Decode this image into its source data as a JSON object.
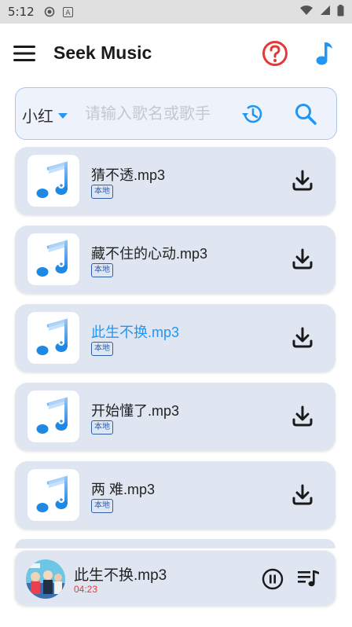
{
  "status_bar": {
    "time": "5:12",
    "icons": [
      "record-icon",
      "a-badge-icon",
      "wifi-icon",
      "signal-icon",
      "battery-icon"
    ]
  },
  "app_bar": {
    "title": "Seek Music",
    "icons": [
      "menu-icon",
      "help-icon",
      "music-note-icon"
    ],
    "colors": {
      "help": "#e53935",
      "music": "#2196f3"
    }
  },
  "search": {
    "source": "小红",
    "placeholder": "请输入歌名或歌手",
    "value": ""
  },
  "songs": [
    {
      "title": "猜不透.mp3",
      "tag": "本地",
      "active": false
    },
    {
      "title": "藏不住的心动.mp3",
      "tag": "本地",
      "active": false
    },
    {
      "title": "此生不换.mp3",
      "tag": "本地",
      "active": true
    },
    {
      "title": "开始懂了.mp3",
      "tag": "本地",
      "active": false
    },
    {
      "title": "两 难.mp3",
      "tag": "本地",
      "active": false
    }
  ],
  "player": {
    "title": "此生不换.mp3",
    "time": "04:23",
    "state": "playing"
  },
  "colors": {
    "accent": "#2196f3",
    "card_bg": "#dfe6f1",
    "time_red": "#e53935"
  }
}
